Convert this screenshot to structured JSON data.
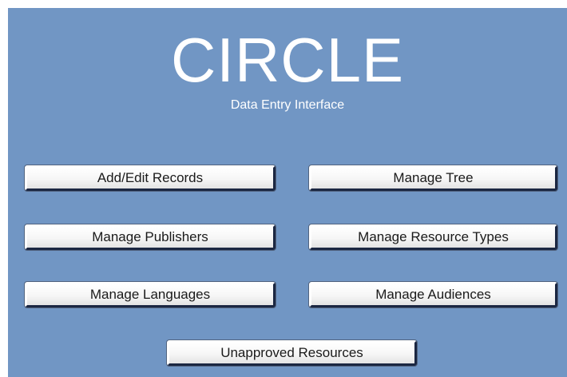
{
  "header": {
    "title": "CIRCLE",
    "subtitle": "Data Entry Interface"
  },
  "menu": {
    "add_edit_records": "Add/Edit Records",
    "manage_tree": "Manage Tree",
    "manage_publishers": "Manage Publishers",
    "manage_resource_types": "Manage Resource Types",
    "manage_languages": "Manage Languages",
    "manage_audiences": "Manage Audiences",
    "unapproved_resources": "Unapproved Resources"
  },
  "colors": {
    "panel_background": "#7196c4",
    "title_text": "#ffffff",
    "button_face": "#f6f6f6",
    "button_shadow": "#1b2742"
  }
}
